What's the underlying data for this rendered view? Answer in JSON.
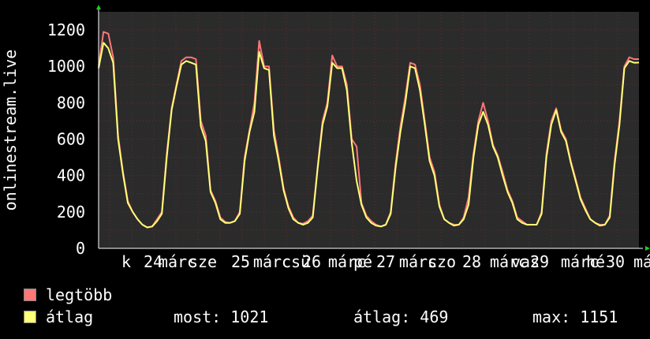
{
  "chart_data": {
    "type": "line",
    "ylabel": "onlinestream.live",
    "ylim": [
      0,
      1300
    ],
    "yticks": [
      0,
      200,
      400,
      600,
      800,
      1000,
      1200
    ],
    "grid": true,
    "x_tick_labels": [
      "k",
      "24",
      "márc",
      "sze",
      "25",
      "márc",
      "csü",
      "26",
      "márc",
      "pé",
      "27",
      "márc",
      "szo",
      "28",
      "márc",
      "vas",
      "29",
      "márc",
      "hé",
      "30",
      "má"
    ],
    "series": [
      {
        "name": "legtöbb",
        "color": "#ff7777",
        "values": [
          1000,
          1190,
          1180,
          1050,
          620,
          420,
          260,
          200,
          160,
          130,
          115,
          120,
          160,
          200,
          520,
          770,
          900,
          1030,
          1050,
          1050,
          1040,
          700,
          620,
          320,
          260,
          170,
          145,
          140,
          150,
          200,
          500,
          650,
          800,
          1140,
          1000,
          1000,
          650,
          500,
          330,
          230,
          170,
          140,
          135,
          150,
          180,
          450,
          700,
          800,
          1060,
          1000,
          1000,
          900,
          600,
          560,
          250,
          180,
          150,
          130,
          120,
          130,
          200,
          460,
          670,
          830,
          1020,
          1010,
          900,
          700,
          500,
          420,
          240,
          160,
          140,
          130,
          130,
          170,
          280,
          520,
          700,
          800,
          700,
          570,
          510,
          420,
          320,
          260,
          170,
          150,
          130,
          130,
          130,
          200,
          520,
          700,
          770,
          650,
          600,
          480,
          380,
          280,
          220,
          160,
          140,
          130,
          130,
          180,
          480,
          700,
          1000,
          1050,
          1040,
          1040
        ]
      },
      {
        "name": "átlag",
        "color": "#ffff77",
        "values": [
          990,
          1130,
          1100,
          1020,
          600,
          410,
          250,
          200,
          160,
          130,
          115,
          120,
          150,
          190,
          500,
          760,
          890,
          1010,
          1030,
          1020,
          1010,
          670,
          590,
          310,
          250,
          160,
          140,
          140,
          150,
          190,
          480,
          640,
          750,
          1080,
          990,
          980,
          620,
          480,
          320,
          220,
          160,
          140,
          130,
          140,
          170,
          440,
          680,
          780,
          1020,
          990,
          990,
          870,
          580,
          370,
          240,
          170,
          140,
          125,
          120,
          130,
          190,
          440,
          640,
          800,
          1000,
          990,
          870,
          680,
          480,
          400,
          230,
          160,
          140,
          125,
          130,
          160,
          240,
          500,
          680,
          750,
          680,
          560,
          500,
          400,
          310,
          250,
          160,
          140,
          130,
          130,
          130,
          190,
          500,
          680,
          760,
          640,
          590,
          470,
          370,
          270,
          210,
          160,
          140,
          125,
          130,
          170,
          460,
          680,
          990,
          1030,
          1020,
          1021
        ]
      }
    ]
  },
  "legend": {
    "max_label": "legtöbb",
    "avg_label": "átlag",
    "max_color": "#ff7777",
    "avg_color": "#ffff77"
  },
  "stats": {
    "current": "most: 1021",
    "average": "átlag: 469",
    "maximum": "max: 1151"
  }
}
